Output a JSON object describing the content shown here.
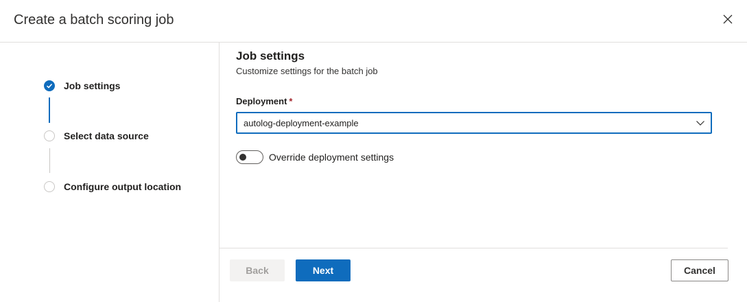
{
  "dialog": {
    "title": "Create a batch scoring job",
    "close_icon": "close-icon"
  },
  "steps": [
    {
      "label": "Job settings",
      "state": "active",
      "icon": "checkmark-circle-icon"
    },
    {
      "label": "Select data source",
      "state": "inactive",
      "icon": "empty-circle-icon"
    },
    {
      "label": "Configure output location",
      "state": "inactive",
      "icon": "empty-circle-icon"
    }
  ],
  "section": {
    "title": "Job settings",
    "subtitle": "Customize settings for the batch job"
  },
  "deployment": {
    "label": "Deployment",
    "required_marker": "*",
    "value": "autolog-deployment-example",
    "icon": "chevron-down-icon"
  },
  "override": {
    "label": "Override deployment settings",
    "on": false
  },
  "footer": {
    "back_label": "Back",
    "next_label": "Next",
    "cancel_label": "Cancel"
  },
  "colors": {
    "accent": "#0f6cbd",
    "required": "#a4262c",
    "disabled_bg": "#f3f2f1",
    "border": "#e1dfdd"
  }
}
